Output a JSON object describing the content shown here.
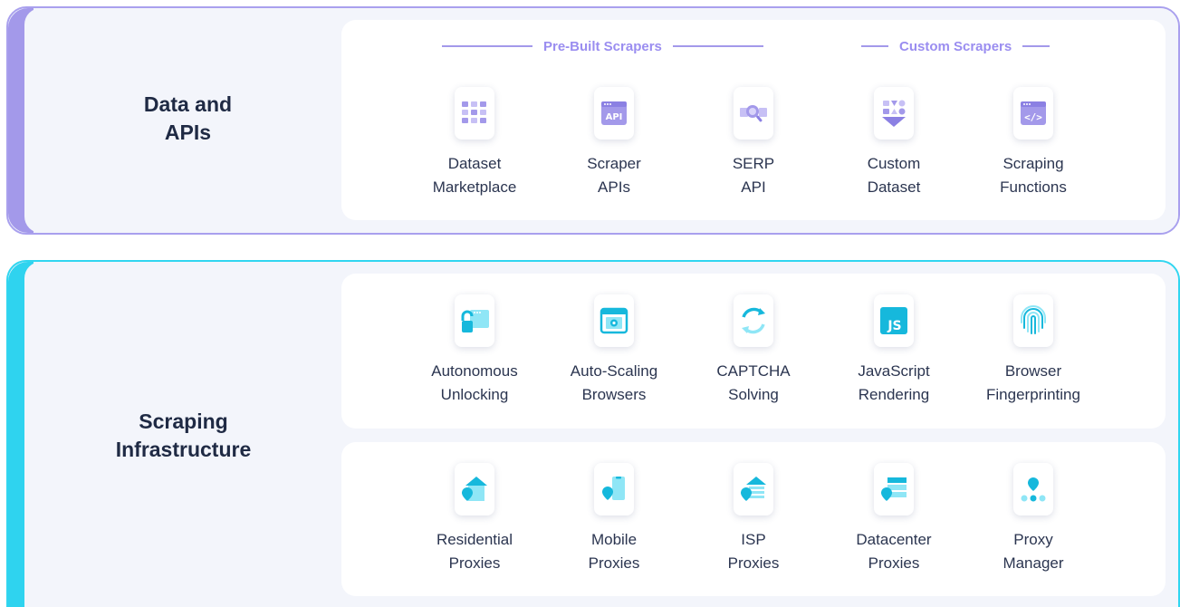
{
  "sections": {
    "data": {
      "title_line1": "Data and",
      "title_line2": "APIs",
      "accent_color": "#a399ea",
      "groups": {
        "prebuilt": "Pre-Built Scrapers",
        "custom": "Custom Scrapers"
      },
      "items": [
        {
          "line1": "Dataset",
          "line2": "Marketplace",
          "icon": "dataset-grid-icon"
        },
        {
          "line1": "Scraper",
          "line2": "APIs",
          "icon": "api-window-icon"
        },
        {
          "line1": "SERP",
          "line2": "API",
          "icon": "search-magnifier-icon"
        },
        {
          "line1": "Custom",
          "line2": "Dataset",
          "icon": "custom-dataset-icon"
        },
        {
          "line1": "Scraping",
          "line2": "Functions",
          "icon": "code-window-icon"
        }
      ]
    },
    "infra": {
      "title_line1": "Scraping",
      "title_line2": "Infrastructure",
      "accent_color": "#2fd3ef",
      "unlocker_items": [
        {
          "line1": "Autonomous",
          "line2": "Unlocking",
          "icon": "unlock-padlock-icon"
        },
        {
          "line1": "Auto-Scaling",
          "line2": "Browsers",
          "icon": "browser-gear-icon"
        },
        {
          "line1": "CAPTCHA",
          "line2": "Solving",
          "icon": "captcha-refresh-icon"
        },
        {
          "line1": "JavaScript",
          "line2": "Rendering",
          "icon": "javascript-icon"
        },
        {
          "line1": "Browser",
          "line2": "Fingerprinting",
          "icon": "fingerprint-icon"
        }
      ],
      "proxy_items": [
        {
          "line1": "Residential",
          "line2": "Proxies",
          "icon": "residential-proxy-icon"
        },
        {
          "line1": "Mobile",
          "line2": "Proxies",
          "icon": "mobile-proxy-icon"
        },
        {
          "line1": "ISP",
          "line2": "Proxies",
          "icon": "isp-proxy-icon"
        },
        {
          "line1": "Datacenter",
          "line2": "Proxies",
          "icon": "datacenter-proxy-icon"
        },
        {
          "line1": "Proxy",
          "line2": "Manager",
          "icon": "proxy-manager-icon"
        }
      ]
    }
  }
}
